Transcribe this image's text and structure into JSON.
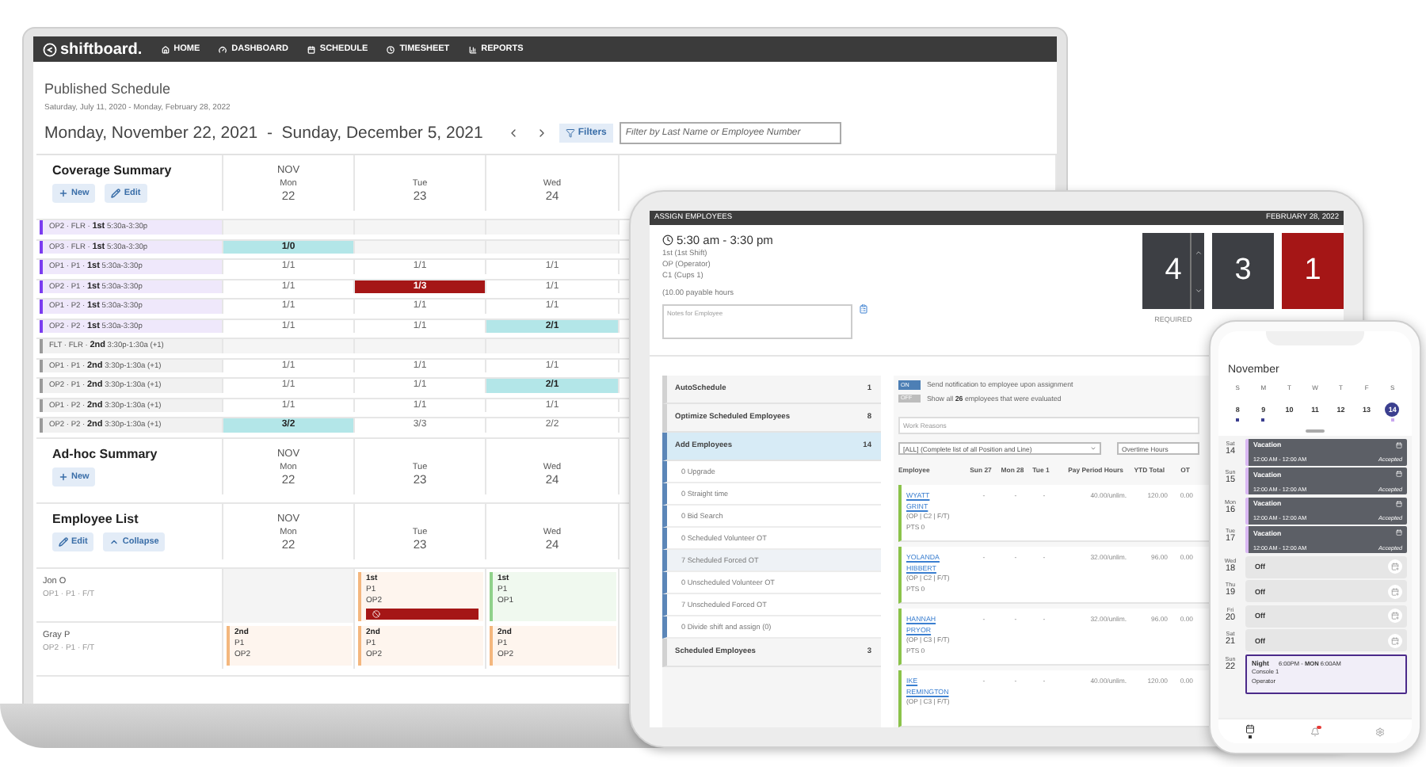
{
  "laptop": {
    "logo": "shiftboard.",
    "nav": [
      "HOME",
      "DASHBOARD",
      "SCHEDULE",
      "TIMESHEET",
      "REPORTS"
    ],
    "title": "Published Schedule",
    "published_range": "Saturday, July 11, 2020 - Monday, February 28, 2022",
    "week_range": "Monday, November 22, 2021  -  Sunday, December 5, 2021",
    "filters_button": "Filters",
    "filter_field": {
      "placeholder": "Filter by Last Name or Employee Number"
    },
    "coverage": {
      "title": "Coverage Summary",
      "buttons": [
        {
          "label": "New",
          "kind": "add"
        },
        {
          "label": "Edit",
          "kind": "edit"
        }
      ],
      "days": [
        {
          "month": "NOV",
          "weekday": "Mon",
          "date": "22"
        },
        {
          "weekday": "Tue",
          "date": "23"
        },
        {
          "weekday": "Wed",
          "date": "24"
        }
      ],
      "rows": [
        {
          "label": "OP2 · FLR · **1st** 5:30a-3:30p",
          "kind": "first",
          "cells": [
            {
              "kind": "empty"
            },
            {
              "kind": "empty"
            },
            {
              "kind": "empty"
            }
          ]
        },
        {
          "label": "OP3 · FLR · **1st** 5:30a-3:30p",
          "kind": "first",
          "cells": [
            {
              "text": "1/0",
              "kind": "over"
            },
            {
              "kind": "empty"
            },
            {
              "kind": "empty"
            }
          ]
        },
        {
          "label": "OP1 · P1 · **1st** 5:30a-3:30p",
          "kind": "first",
          "cells": [
            {
              "text": "1/1",
              "kind": "normal"
            },
            {
              "text": "1/1",
              "kind": "normal"
            },
            {
              "text": "1/1",
              "kind": "normal"
            }
          ]
        },
        {
          "label": "OP2 · P1 · **1st** 5:30a-3:30p",
          "kind": "first",
          "cells": [
            {
              "text": "1/1",
              "kind": "normal"
            },
            {
              "text": "1/3",
              "kind": "under"
            },
            {
              "text": "1/1",
              "kind": "normal"
            }
          ]
        },
        {
          "label": "OP1 · P2 · **1st** 5:30a-3:30p",
          "kind": "first",
          "cells": [
            {
              "text": "1/1",
              "kind": "normal"
            },
            {
              "text": "1/1",
              "kind": "normal"
            },
            {
              "text": "1/1",
              "kind": "normal"
            }
          ]
        },
        {
          "label": "OP2 · P2 · **1st** 5:30a-3:30p",
          "kind": "first",
          "cells": [
            {
              "text": "1/1",
              "kind": "normal"
            },
            {
              "text": "1/1",
              "kind": "normal"
            },
            {
              "text": "2/1",
              "kind": "over"
            }
          ]
        },
        {
          "label": "FLT · FLR · **2nd** 3:30p-1:30a (+1)",
          "kind": "second",
          "cells": [
            {
              "kind": "empty"
            },
            {
              "kind": "empty"
            },
            {
              "kind": "empty"
            }
          ]
        },
        {
          "label": "OP1 · P1 · **2nd** 3:30p-1:30a (+1)",
          "kind": "second",
          "cells": [
            {
              "text": "1/1",
              "kind": "normal"
            },
            {
              "text": "1/1",
              "kind": "normal"
            },
            {
              "text": "1/1",
              "kind": "normal"
            }
          ]
        },
        {
          "label": "OP2 · P1 · **2nd** 3:30p-1:30a (+1)",
          "kind": "second",
          "cells": [
            {
              "text": "1/1",
              "kind": "normal"
            },
            {
              "text": "1/1",
              "kind": "normal"
            },
            {
              "text": "2/1",
              "kind": "over"
            }
          ]
        },
        {
          "label": "OP1 · P2 · **2nd** 3:30p-1:30a (+1)",
          "kind": "second",
          "cells": [
            {
              "text": "1/1",
              "kind": "normal"
            },
            {
              "text": "1/1",
              "kind": "normal"
            },
            {
              "text": "1/1",
              "kind": "normal"
            }
          ]
        },
        {
          "label": "OP2 · P2 · **2nd** 3:30p-1:30a (+1)",
          "kind": "second",
          "cells": [
            {
              "text": "3/2",
              "kind": "over"
            },
            {
              "text": "3/3",
              "kind": "normal"
            },
            {
              "text": "2/2",
              "kind": "normal"
            }
          ]
        }
      ]
    },
    "adhoc": {
      "title": "Ad-hoc Summary",
      "buttons": [
        {
          "label": "New",
          "kind": "add"
        }
      ],
      "days": [
        {
          "month": "NOV",
          "weekday": "Mon",
          "date": "22"
        },
        {
          "weekday": "Tue",
          "date": "23"
        },
        {
          "weekday": "Wed",
          "date": "24"
        }
      ]
    },
    "employee_list": {
      "title": "Employee List",
      "buttons": [
        {
          "label": "Edit",
          "kind": "edit"
        },
        {
          "label": "Collapse",
          "kind": "collapse"
        }
      ],
      "days": [
        {
          "month": "NOV",
          "weekday": "Mon",
          "date": "22"
        },
        {
          "weekday": "Tue",
          "date": "23"
        },
        {
          "weekday": "Wed",
          "date": "24"
        }
      ],
      "employees": [
        {
          "name": "Jon O",
          "detail": "OP1 · P1 · F/T",
          "shifts": [
            {
              "kind": "empty"
            },
            {
              "kind": "shift",
              "shift": "1st",
              "lines": [
                "P1",
                "OP2"
              ],
              "color": "#f4b77e",
              "alert": true
            },
            {
              "kind": "shift",
              "shift": "1st",
              "lines": [
                "P1",
                "OP1"
              ],
              "color": "#8fd18a",
              "alert": false
            }
          ]
        },
        {
          "name": "Gray P",
          "detail": "OP2 · P1 · F/T",
          "shifts": [
            {
              "kind": "shift",
              "shift": "2nd",
              "lines": [
                "P1",
                "OP2"
              ],
              "color": "#f4b77e",
              "alert": false
            },
            {
              "kind": "shift",
              "shift": "2nd",
              "lines": [
                "P1",
                "OP2"
              ],
              "color": "#f4b77e",
              "alert": false
            },
            {
              "kind": "shift",
              "shift": "2nd",
              "lines": [
                "P1",
                "OP2"
              ],
              "color": "#f4b77e",
              "alert": false
            }
          ]
        }
      ]
    }
  },
  "tablet": {
    "title": "ASSIGN EMPLOYEES",
    "date": "FEBRUARY 28, 2022",
    "time": "5:30 am - 3:30 pm",
    "details": [
      "1st (1st Shift)",
      "OP (Operator)",
      "C1 (Cups 1)"
    ],
    "hours": "(10.00 payable hours",
    "notes_field": {
      "placeholder": "Notes for Employee"
    },
    "counters": [
      {
        "value": "4",
        "kind": "stepper",
        "label": "REQUIRED"
      },
      {
        "value": "3",
        "kind": "plain"
      },
      {
        "value": "1",
        "kind": "alert"
      }
    ],
    "menu": [
      {
        "label": "AutoSchedule",
        "count": "1",
        "selected": false
      },
      {
        "label": "Optimize Scheduled Employees",
        "count": "8",
        "selected": false
      },
      {
        "label": "Add Employees",
        "count": "14",
        "selected": true,
        "children": [
          {
            "label": "0 Upgrade",
            "selected": false
          },
          {
            "label": "0 Straight time",
            "selected": false
          },
          {
            "label": "0 Bid Search",
            "selected": false
          },
          {
            "label": "0 Scheduled Volunteer OT",
            "selected": false
          },
          {
            "label": "7 Scheduled Forced OT",
            "selected": true
          },
          {
            "label": "0 Unscheduled Volunteer OT",
            "selected": false
          },
          {
            "label": "7 Unscheduled Forced OT",
            "selected": false
          },
          {
            "label": "0 Divide shift and assign (0)",
            "selected": false
          }
        ]
      },
      {
        "label": "Scheduled Employees",
        "count": "3",
        "selected": false
      }
    ],
    "toggles": [
      {
        "label": "ON",
        "on": true,
        "text": "Send notification to employee upon assignment"
      },
      {
        "label": "OFF",
        "on": false,
        "text": "Show all **26** employees that were evaluated"
      }
    ],
    "reasons_field": {
      "placeholder": "Work Reasons"
    },
    "position_select": "[ALL] (Complete list of all Position and Line)",
    "hours_select": "Overtime Hours",
    "employee_column": "Employee",
    "columns": [
      "Sun 27",
      "Mon 28",
      "Tue 1",
      "Pay Period Hours",
      "YTD Total",
      "OT"
    ],
    "rows": [
      {
        "first": "WYATT",
        "last": "GRINT",
        "detail": "(OP | C2 | F/T)",
        "pts": "PTS 0",
        "cells": [
          "-",
          "-",
          "-",
          "40.00/unlim.",
          "120.00",
          "0.00"
        ]
      },
      {
        "first": "YOLANDA",
        "last": "HIBBERT",
        "detail": "(OP | C2 | F/T)",
        "pts": "PTS 0",
        "cells": [
          "-",
          "-",
          "-",
          "32.00/unlim.",
          "96.00",
          "0.00"
        ]
      },
      {
        "first": "HANNAH",
        "last": "PRYOR",
        "detail": "(OP | C3 | F/T)",
        "pts": "PTS 0",
        "cells": [
          "-",
          "-",
          "-",
          "32.00/unlim.",
          "96.00",
          "0.00"
        ]
      },
      {
        "first": "IKE",
        "last": "REMINGTON",
        "detail": "(OP | C3 | F/T)",
        "cells": [
          "-",
          "-",
          "-",
          "40.00/unlim.",
          "120.00",
          "0.00"
        ]
      }
    ]
  },
  "phone": {
    "month": "November",
    "weekdays": [
      "S",
      "M",
      "T",
      "W",
      "T",
      "F",
      "S"
    ],
    "dates": [
      {
        "day": "8",
        "dot": true,
        "selected": false
      },
      {
        "day": "9",
        "dot": true,
        "selected": false
      },
      {
        "day": "10",
        "dot": false,
        "selected": false
      },
      {
        "day": "11",
        "dot": false,
        "selected": false
      },
      {
        "day": "12",
        "dot": false,
        "selected": false
      },
      {
        "day": "13",
        "dot": false,
        "selected": false
      },
      {
        "day": "14",
        "dot": true,
        "selected": true
      }
    ],
    "entries": [
      {
        "weekday": "Sat",
        "date": "14",
        "kind": "vacation",
        "title": "Vacation",
        "time": "12:00 AM - 12:00 AM",
        "status": "Accepted"
      },
      {
        "weekday": "Sun",
        "date": "15",
        "kind": "vacation",
        "title": "Vacation",
        "time": "12:00 AM - 12:00 AM",
        "status": "Accepted"
      },
      {
        "weekday": "Mon",
        "date": "16",
        "kind": "vacation",
        "title": "Vacation",
        "time": "12:00 AM - 12:00 AM",
        "status": "Accepted"
      },
      {
        "weekday": "Tue",
        "date": "17",
        "kind": "vacation",
        "title": "Vacation",
        "time": "12:00 AM - 12:00 AM",
        "status": "Accepted"
      },
      {
        "weekday": "Wed",
        "date": "18",
        "kind": "off",
        "title": "Off"
      },
      {
        "weekday": "Thu",
        "date": "19",
        "kind": "off",
        "title": "Off"
      },
      {
        "weekday": "Fri",
        "date": "20",
        "kind": "off",
        "title": "Off"
      },
      {
        "weekday": "Sat",
        "date": "21",
        "kind": "off",
        "title": "Off"
      },
      {
        "weekday": "Sun",
        "date": "22",
        "kind": "shift",
        "title": "Night",
        "time": "6:00PM - **MON** 6:00AM",
        "lines": [
          "Console 1",
          "Operator"
        ]
      }
    ],
    "tabs": [
      {
        "kind": "calendar",
        "selected": true,
        "badge": false
      },
      {
        "kind": "bell",
        "selected": false,
        "badge": true
      },
      {
        "kind": "gear",
        "selected": false,
        "badge": false
      }
    ]
  }
}
